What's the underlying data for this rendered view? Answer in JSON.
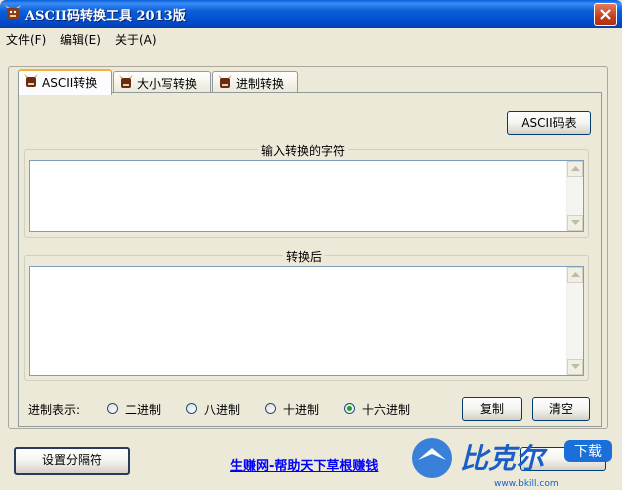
{
  "window": {
    "title": "ASCII码转换工具 2013版"
  },
  "menu": {
    "items": [
      "文件(F)",
      "编辑(E)",
      "关于(A)"
    ]
  },
  "tabs": [
    {
      "label": "ASCII转换",
      "active": true
    },
    {
      "label": "大小写转换",
      "active": false
    },
    {
      "label": "进制转换",
      "active": false
    }
  ],
  "ascii_table_button": "ASCII码表",
  "input_group": {
    "label": "输入转换的字符",
    "value": ""
  },
  "output_group": {
    "label": "转换后",
    "value": ""
  },
  "base": {
    "label": "进制表示:",
    "options": [
      {
        "label": "二进制",
        "checked": false
      },
      {
        "label": "八进制",
        "checked": false
      },
      {
        "label": "十进制",
        "checked": false
      },
      {
        "label": "十六进制",
        "checked": true
      }
    ]
  },
  "buttons": {
    "copy": "复制",
    "clear": "清空",
    "separator": "设置分隔符"
  },
  "footer_link": "生赚网-帮助天下草根赚钱",
  "watermark": {
    "text": "比克尔",
    "tag": "下载",
    "url": "www.bkill.com"
  },
  "colors": {
    "accent": "#0a5fd8",
    "link": "#0000ff",
    "tab_highlight": "#f2b33d"
  }
}
